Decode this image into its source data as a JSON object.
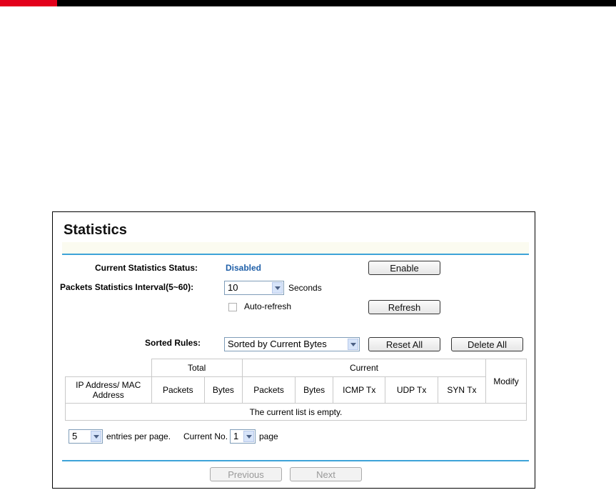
{
  "page": {
    "title": "Statistics"
  },
  "form": {
    "status_label": "Current Statistics Status:",
    "status_value": "Disabled",
    "enable_button": "Enable",
    "interval_label": "Packets Statistics Interval(5~60):",
    "interval_value": "10",
    "interval_unit": "Seconds",
    "auto_refresh_label": "Auto-refresh",
    "auto_refresh_checked": false,
    "refresh_button": "Refresh",
    "sorted_label": "Sorted Rules:",
    "sorted_value": "Sorted by Current Bytes",
    "reset_all_button": "Reset All",
    "delete_all_button": "Delete All"
  },
  "table": {
    "group_total": "Total",
    "group_current": "Current",
    "col_ip": "IP Address/ MAC Address",
    "col_total_packets": "Packets",
    "col_total_bytes": "Bytes",
    "col_current_packets": "Packets",
    "col_current_bytes": "Bytes",
    "col_icmp": "ICMP Tx",
    "col_udp": "UDP Tx",
    "col_syn": "SYN Tx",
    "col_modify": "Modify",
    "empty_message": "The current list is empty."
  },
  "pagination": {
    "entries_value": "5",
    "entries_label": "entries per page.",
    "current_label": "Current No.",
    "page_value": "1",
    "page_label": "page",
    "previous_button": "Previous",
    "next_button": "Next"
  },
  "colors": {
    "accent_line": "#3da3d8",
    "status_text": "#1f5fa8",
    "brand_red": "#e3001b"
  }
}
